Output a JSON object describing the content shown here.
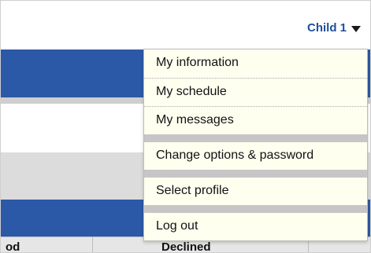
{
  "header": {
    "child_selector": "Child 1"
  },
  "menu": {
    "items": [
      {
        "label": "My information"
      },
      {
        "label": "My schedule"
      },
      {
        "label": "My messages"
      },
      {
        "label": "Change options & password"
      },
      {
        "label": "Select profile"
      },
      {
        "label": "Log out"
      }
    ]
  },
  "table": {
    "headers": [
      "od",
      "Declined"
    ]
  }
}
